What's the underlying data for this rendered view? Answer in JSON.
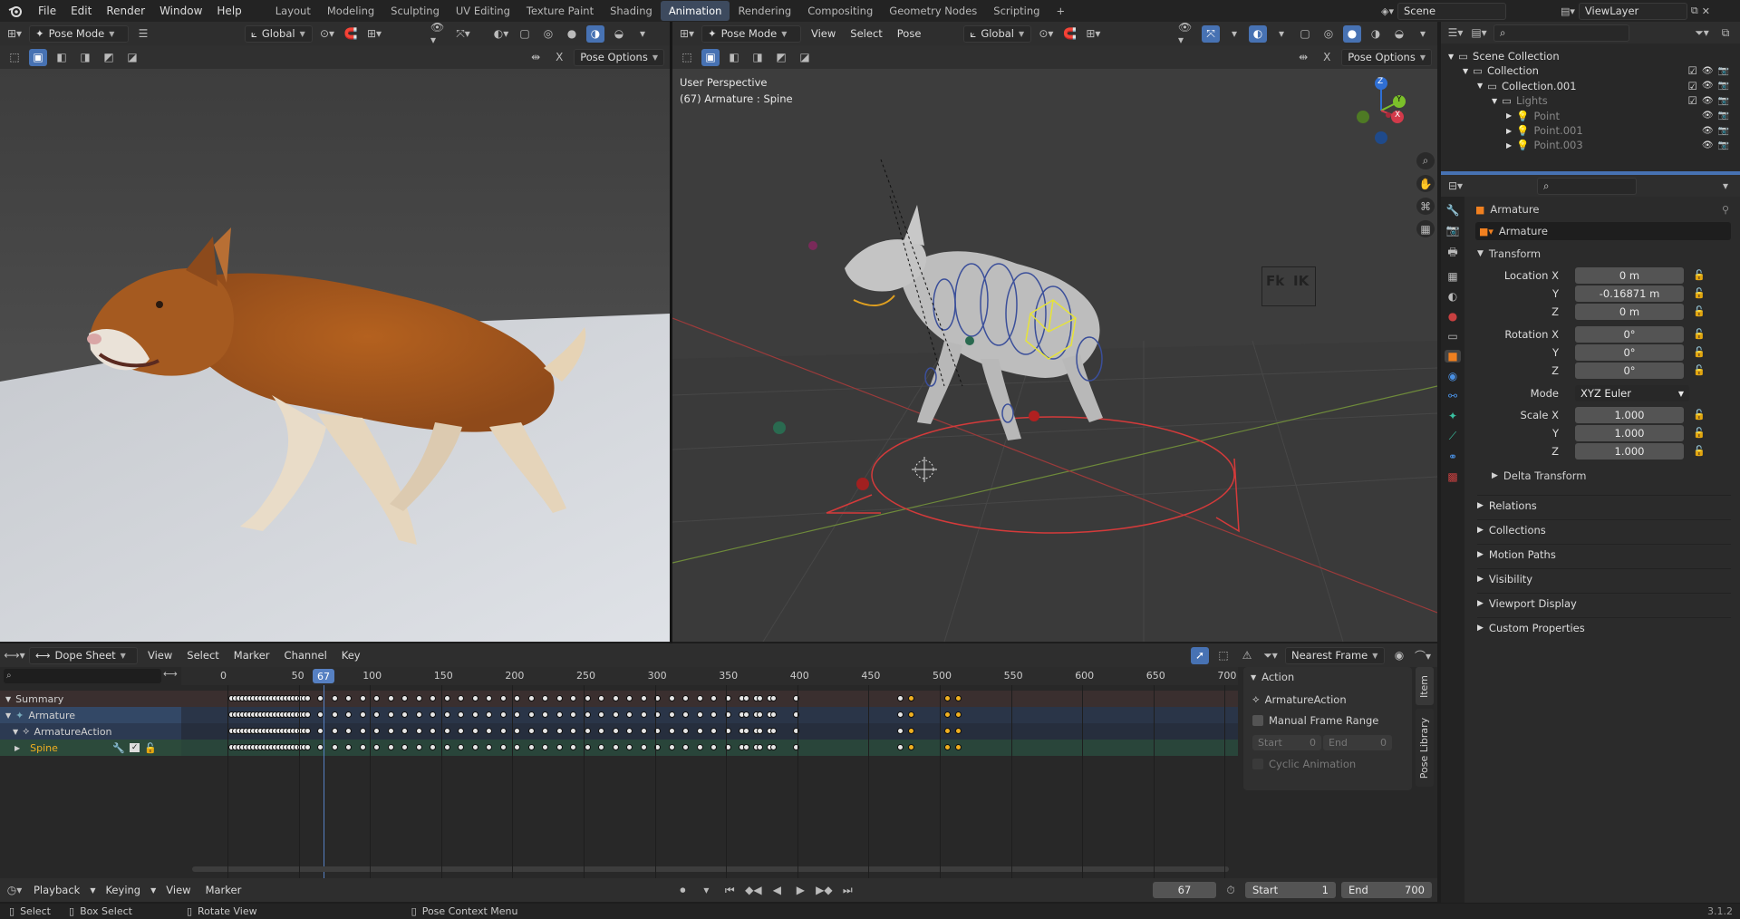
{
  "topbar": {
    "menus": [
      "File",
      "Edit",
      "Render",
      "Window",
      "Help"
    ],
    "workspaces": [
      "Layout",
      "Modeling",
      "Sculpting",
      "UV Editing",
      "Texture Paint",
      "Shading",
      "Animation",
      "Rendering",
      "Compositing",
      "Geometry Nodes",
      "Scripting"
    ],
    "active_workspace": "Animation",
    "add_tab": "+",
    "scene": "Scene",
    "view_layer": "ViewLayer"
  },
  "left_viewport": {
    "mode": "Pose Mode",
    "orientation": "Global",
    "pose_options": "Pose Options",
    "x_toggle": "X"
  },
  "right_viewport": {
    "mode": "Pose Mode",
    "menus": [
      "View",
      "Select",
      "Pose"
    ],
    "orientation": "Global",
    "pose_options": "Pose Options",
    "x_toggle": "X",
    "overlay_title": "User Perspective",
    "overlay_subtitle": "(67) Armature : Spine",
    "fk_label": "Fk",
    "ik_label": "IK",
    "gizmo": {
      "z": "Z",
      "y": "Y",
      "x": "X"
    }
  },
  "outliner": {
    "rows": [
      {
        "label": "Scene Collection",
        "depth": 0,
        "kind": "scene"
      },
      {
        "label": "Collection",
        "depth": 1,
        "kind": "collection"
      },
      {
        "label": "Collection.001",
        "depth": 2,
        "kind": "collection"
      },
      {
        "label": "Lights",
        "depth": 3,
        "kind": "collection"
      },
      {
        "label": "Point",
        "depth": 4,
        "kind": "light"
      },
      {
        "label": "Point.001",
        "depth": 4,
        "kind": "light"
      },
      {
        "label": "Point.003",
        "depth": 4,
        "kind": "light"
      }
    ]
  },
  "properties": {
    "object_name": "Armature",
    "data_name": "Armature",
    "transform_title": "Transform",
    "location": {
      "label": "Location X",
      "x": "0 m",
      "y": "-0.16871 m",
      "z": "0 m"
    },
    "rotation": {
      "label": "Rotation X",
      "x": "0°",
      "y": "0°",
      "z": "0°"
    },
    "mode_label": "Mode",
    "mode_value": "XYZ Euler",
    "scale": {
      "label": "Scale X",
      "x": "1.000",
      "y": "1.000",
      "z": "1.000"
    },
    "axis_y": "Y",
    "axis_z": "Z",
    "delta": "Delta Transform",
    "panels": [
      "Relations",
      "Collections",
      "Motion Paths",
      "Visibility",
      "Viewport Display",
      "Custom Properties"
    ]
  },
  "dopesheet": {
    "mode": "Dope Sheet",
    "menus": [
      "View",
      "Select",
      "Marker",
      "Channel",
      "Key"
    ],
    "snap": "Nearest Frame",
    "ruler": [
      "0",
      "50",
      "100",
      "150",
      "200",
      "250",
      "300",
      "350",
      "400",
      "450",
      "500",
      "550",
      "600",
      "650",
      "700"
    ],
    "current_frame": "67",
    "channels": [
      "Summary",
      "Armature",
      "ArmatureAction",
      "Spine"
    ],
    "side_panel": {
      "title": "Action",
      "action_name": "ArmatureAction",
      "manual_range": "Manual Frame Range",
      "start_label": "Start",
      "start_value": "0",
      "end_label": "End",
      "end_value": "0",
      "cyclic": "Cyclic Animation",
      "tabs": [
        "Item",
        "Pose Library"
      ]
    }
  },
  "timeline": {
    "menus": [
      "Playback",
      "Keying",
      "View",
      "Marker"
    ],
    "current_frame": "67",
    "start_label": "Start",
    "start_value": "1",
    "end_label": "End",
    "end_value": "700"
  },
  "statusbar": {
    "select": "Select",
    "box_select": "Box Select",
    "rotate_view": "Rotate View",
    "context_menu": "Pose Context Menu",
    "version": "3.1.2"
  },
  "colors": {
    "accent": "#4772b3",
    "playhead": "#5680c2",
    "selected_key": "#f0b020",
    "armature_row": "#334866",
    "summary_row": "#3a2f2f",
    "spine_row": "#2c4a3b"
  }
}
